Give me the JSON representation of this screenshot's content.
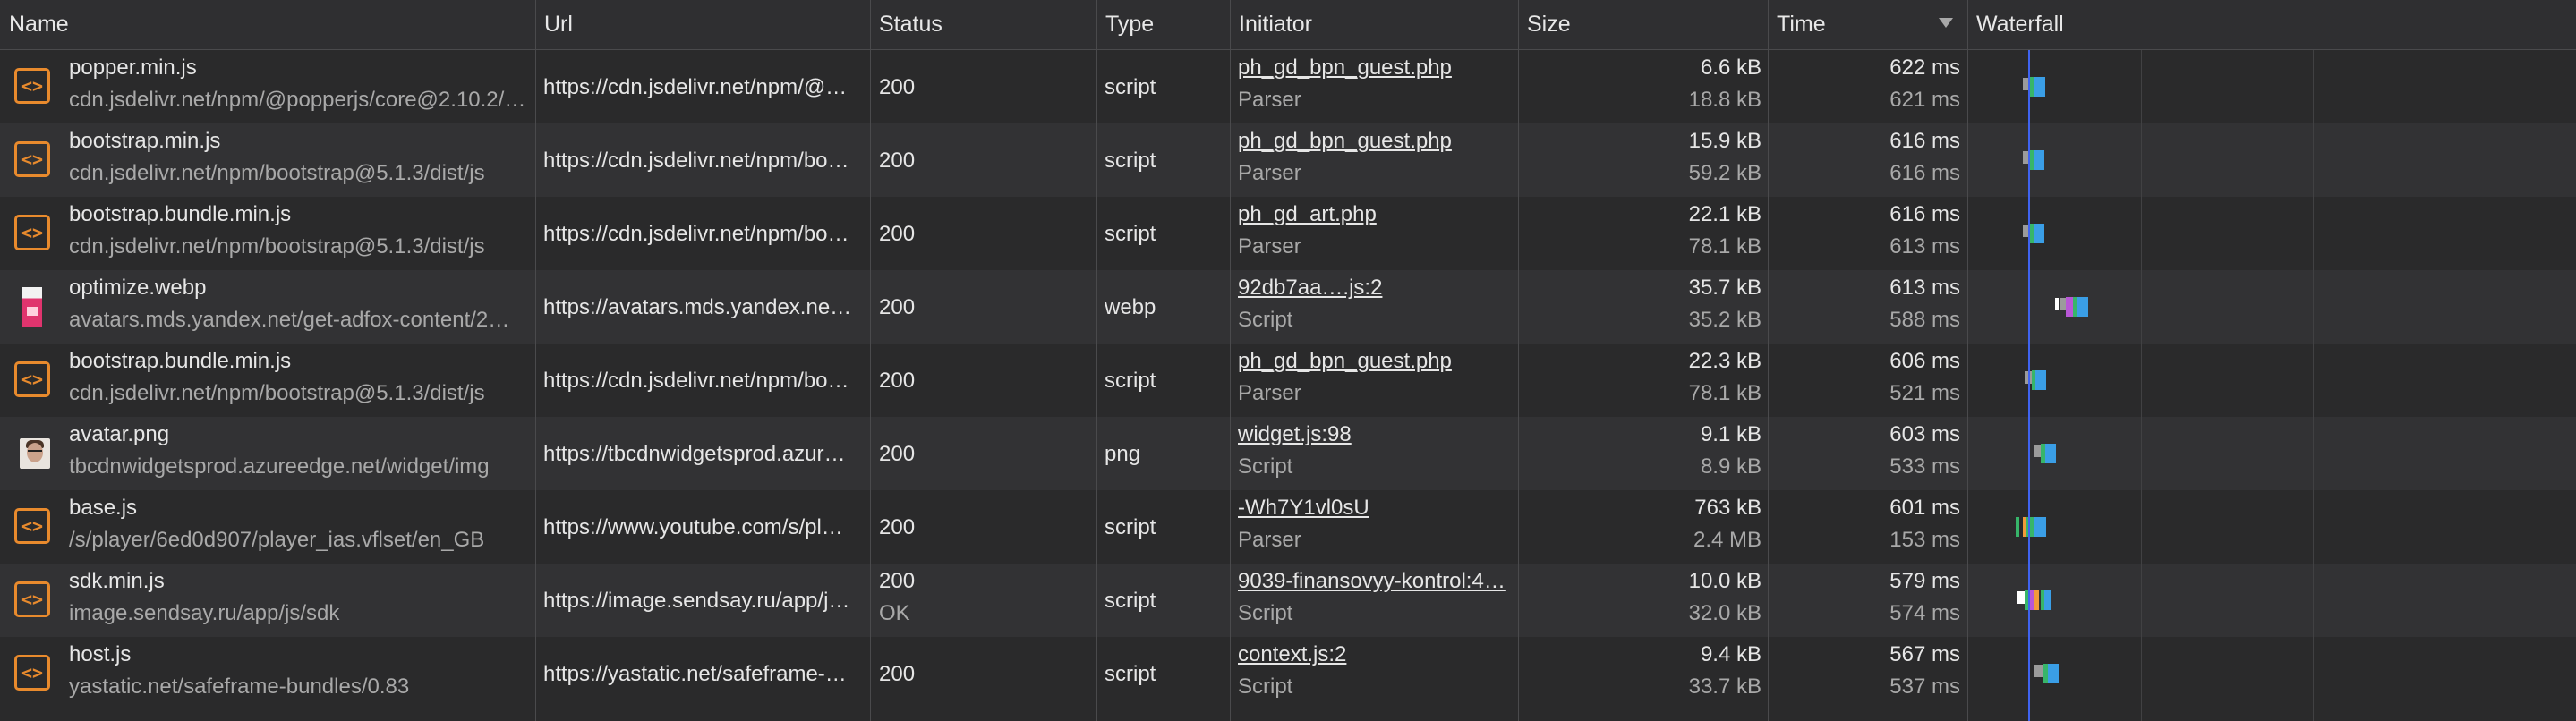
{
  "columns": {
    "name": "Name",
    "url": "Url",
    "status": "Status",
    "type": "Type",
    "initiator": "Initiator",
    "size": "Size",
    "time": "Time",
    "waterfall": "Waterfall"
  },
  "rows": [
    {
      "icon": "script-icon",
      "name": "popper.min.js",
      "path": "cdn.jsdelivr.net/npm/@popperjs/core@2.10.2/…",
      "url": "https://cdn.jsdelivr.net/npm/@…",
      "status": "200",
      "status_text": "",
      "type": "script",
      "initiator": "ph_gd_bpn_guest.php",
      "initiator_type": "Parser",
      "size": "6.6 kB",
      "resource_size": "18.8 kB",
      "time": "622 ms",
      "latency": "621 ms"
    },
    {
      "icon": "script-icon",
      "name": "bootstrap.min.js",
      "path": "cdn.jsdelivr.net/npm/bootstrap@5.1.3/dist/js",
      "url": "https://cdn.jsdelivr.net/npm/bo…",
      "status": "200",
      "status_text": "",
      "type": "script",
      "initiator": "ph_gd_bpn_guest.php",
      "initiator_type": "Parser",
      "size": "15.9 kB",
      "resource_size": "59.2 kB",
      "time": "616 ms",
      "latency": "616 ms"
    },
    {
      "icon": "script-icon",
      "name": "bootstrap.bundle.min.js",
      "path": "cdn.jsdelivr.net/npm/bootstrap@5.1.3/dist/js",
      "url": "https://cdn.jsdelivr.net/npm/bo…",
      "status": "200",
      "status_text": "",
      "type": "script",
      "initiator": "ph_gd_art.php",
      "initiator_type": "Parser",
      "size": "22.1 kB",
      "resource_size": "78.1 kB",
      "time": "616 ms",
      "latency": "613 ms"
    },
    {
      "icon": "webp-image-icon",
      "name": "optimize.webp",
      "path": "avatars.mds.yandex.net/get-adfox-content/2…",
      "url": "https://avatars.mds.yandex.ne…",
      "status": "200",
      "status_text": "",
      "type": "webp",
      "initiator": "92db7aa….js:2",
      "initiator_type": "Script",
      "size": "35.7 kB",
      "resource_size": "35.2 kB",
      "time": "613 ms",
      "latency": "588 ms"
    },
    {
      "icon": "script-icon",
      "name": "bootstrap.bundle.min.js",
      "path": "cdn.jsdelivr.net/npm/bootstrap@5.1.3/dist/js",
      "url": "https://cdn.jsdelivr.net/npm/bo…",
      "status": "200",
      "status_text": "",
      "type": "script",
      "initiator": "ph_gd_bpn_guest.php",
      "initiator_type": "Parser",
      "size": "22.3 kB",
      "resource_size": "78.1 kB",
      "time": "606 ms",
      "latency": "521 ms"
    },
    {
      "icon": "avatar-image-icon",
      "name": "avatar.png",
      "path": "tbcdnwidgetsprod.azureedge.net/widget/img",
      "url": "https://tbcdnwidgetsprod.azur…",
      "status": "200",
      "status_text": "",
      "type": "png",
      "initiator": "widget.js:98",
      "initiator_type": "Script",
      "size": "9.1 kB",
      "resource_size": "8.9 kB",
      "time": "603 ms",
      "latency": "533 ms"
    },
    {
      "icon": "script-icon",
      "name": "base.js",
      "path": "/s/player/6ed0d907/player_ias.vflset/en_GB",
      "url": "https://www.youtube.com/s/pl…",
      "status": "200",
      "status_text": "",
      "type": "script",
      "initiator": "-Wh7Y1vl0sU",
      "initiator_type": "Parser",
      "size": "763 kB",
      "resource_size": "2.4 MB",
      "time": "601 ms",
      "latency": "153 ms"
    },
    {
      "icon": "script-icon",
      "name": "sdk.min.js",
      "path": "image.sendsay.ru/app/js/sdk",
      "url": "https://image.sendsay.ru/app/j…",
      "status": "200",
      "status_text": "OK",
      "type": "script",
      "initiator": "9039-finansovyy-kontrol:4…",
      "initiator_type": "Script",
      "size": "10.0 kB",
      "resource_size": "32.0 kB",
      "time": "579 ms",
      "latency": "574 ms"
    },
    {
      "icon": "script-icon",
      "name": "host.js",
      "path": "yastatic.net/safeframe-bundles/0.83",
      "url": "https://yastatic.net/safeframe-…",
      "status": "200",
      "status_text": "",
      "type": "script",
      "initiator": "context.js:2",
      "initiator_type": "Script",
      "size": "9.4 kB",
      "resource_size": "33.7 kB",
      "time": "567 ms",
      "latency": "537 ms"
    }
  ],
  "waterfall_colors": {
    "queue": "#9b9b9b",
    "connect": "#f29a3a",
    "ssl": "#b857d6",
    "wait": "#37b56a",
    "download": "#3a9ee6",
    "stall": "#ffffff",
    "dom_line": "#3f63f0"
  },
  "icon_glyph": "<>"
}
